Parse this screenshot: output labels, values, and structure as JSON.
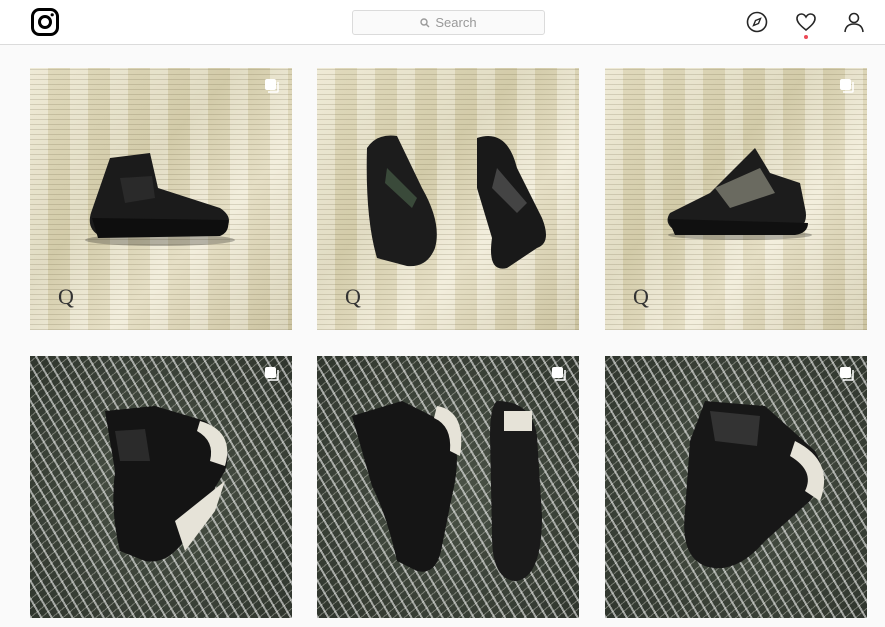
{
  "header": {
    "search_placeholder": "Search",
    "icons": [
      "instagram-logo-icon",
      "explore-compass-icon",
      "heart-icon",
      "profile-icon"
    ],
    "notification_dot_color": "#ed4956"
  },
  "grid": {
    "posts": [
      {
        "style": "paper",
        "indicator": "carousel-icon",
        "watermark": "Q"
      },
      {
        "style": "paper",
        "indicator": "",
        "watermark": "Q"
      },
      {
        "style": "paper",
        "indicator": "carousel-icon",
        "watermark": "Q"
      },
      {
        "style": "scribble",
        "indicator": "carousel-icon",
        "watermark": ""
      },
      {
        "style": "scribble",
        "indicator": "carousel-icon",
        "watermark": ""
      },
      {
        "style": "scribble",
        "indicator": "carousel-icon",
        "watermark": ""
      }
    ]
  }
}
